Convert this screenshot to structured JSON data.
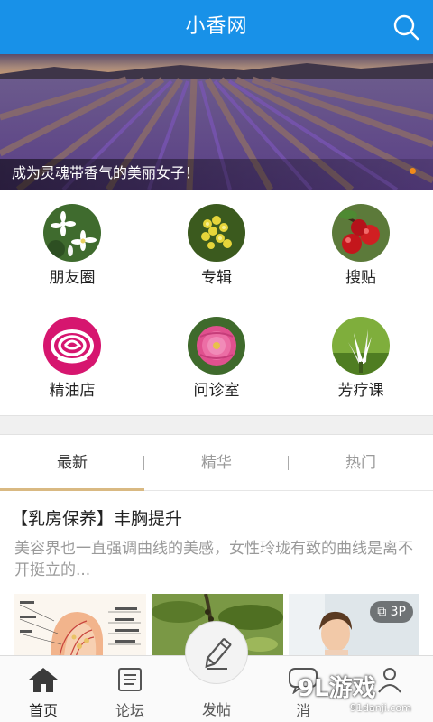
{
  "header": {
    "title": "小香网",
    "search_icon": "search-icon"
  },
  "banner": {
    "caption": "成为灵魂带香气的美丽女子！",
    "indicator_color": "#f18a1a"
  },
  "grid": {
    "items": [
      {
        "label": "朋友圈",
        "icon": "white-jasmine-flower-icon"
      },
      {
        "label": "专辑",
        "icon": "yellow-flower-icon"
      },
      {
        "label": "搜贴",
        "icon": "red-berries-icon"
      },
      {
        "label": "精油店",
        "icon": "pink-rose-logo-icon"
      },
      {
        "label": "问诊室",
        "icon": "pink-rose-flower-icon"
      },
      {
        "label": "芳疗课",
        "icon": "white-magnolia-icon"
      }
    ]
  },
  "tabs": {
    "items": [
      "最新",
      "精华",
      "热门"
    ],
    "active": "最新",
    "accent": "#d9b982"
  },
  "article": {
    "title": "【乳房保养】丰胸提升",
    "summary": "美容界也一直强调曲线的美感，女性玲珑有致的曲线是离不开挺立的...",
    "image_count_badge": "3P"
  },
  "bottom_nav": {
    "items": [
      {
        "label": "首页",
        "icon": "home-icon"
      },
      {
        "label": "论坛",
        "icon": "forum-scroll-icon"
      },
      {
        "label": "发帖",
        "icon": "pen-icon"
      },
      {
        "label": "消",
        "icon": "message-icon"
      },
      {
        "label": "",
        "icon": "user-icon"
      }
    ],
    "active": "首页"
  },
  "watermark": {
    "main": "9L游戏",
    "sub": "91danji.com"
  },
  "colors": {
    "header_bg": "#1891e8",
    "brand_blue": "#1891e8"
  }
}
